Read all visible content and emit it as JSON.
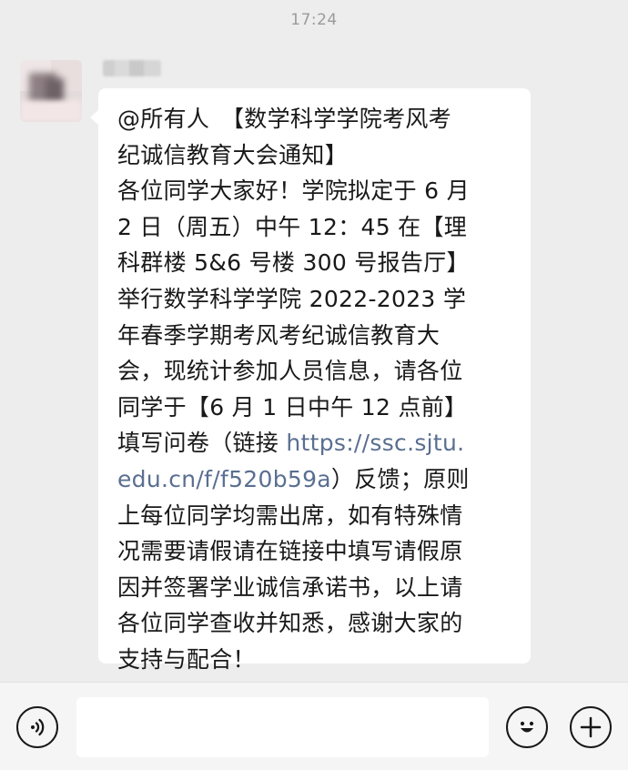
{
  "status": {
    "time": "17:24"
  },
  "chat": {
    "sender": {
      "avatar_icon": "blurred-avatar",
      "name": ""
    },
    "message": {
      "lines": [
        {
          "text": "@所有人　【数学科学学院考风考"
        },
        {
          "text": "纪诚信教育大会通知】"
        },
        {
          "text": "各位同学大家好！学院拟定于 6 月"
        },
        {
          "text": "2 日（周五）中午 12：45 在【理"
        },
        {
          "text": "科群楼 5&6 号楼 300 号报告厅】"
        },
        {
          "text": "举行数学科学学院 2022-2023 学"
        },
        {
          "text": "年春季学期考风考纪诚信教育大"
        },
        {
          "text": "会，现统计参加人员信息，请各位"
        },
        {
          "text": "同学于【6 月 1 日中午 12 点前】"
        },
        {
          "text": "填写问卷（链接 ",
          "link": "https://ssc.sjtu."
        },
        {
          "link": "edu.cn/f/f520b59a",
          "text": "）反馈；原则"
        },
        {
          "text": "上每位同学均需出席，如有特殊情"
        },
        {
          "text": "况需要请假请在链接中填写请假原"
        },
        {
          "text": "因并签署学业诚信承诺书，以上请"
        },
        {
          "text": "各位同学查收并知悉，感谢大家的"
        },
        {
          "text": "支持与配合！"
        }
      ]
    }
  },
  "input_bar": {
    "voice_icon": "voice-icon",
    "input_value": "",
    "emoji_icon": "emoji-icon",
    "plus_icon": "plus-icon"
  },
  "colors": {
    "background": "#ededed",
    "bubble": "#ffffff",
    "link": "#5a6f91",
    "text": "#191919",
    "timestamp": "#9b9b9b"
  }
}
